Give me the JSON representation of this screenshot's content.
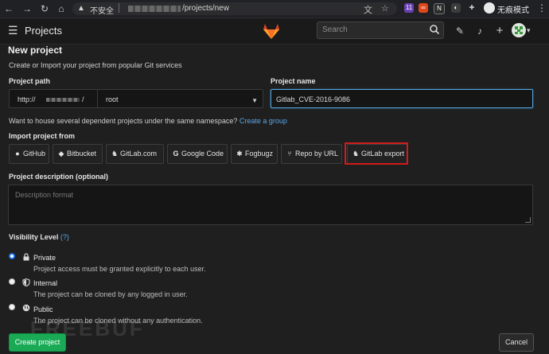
{
  "browser": {
    "security_label": "不安全",
    "url_path": "/projects/new",
    "ext_badge": "11",
    "incognito_label": "无痕模式"
  },
  "header": {
    "app_title": "Projects",
    "search_placeholder": "Search"
  },
  "page": {
    "title": "New project",
    "subtitle": "Create or Import your project from popular Git services"
  },
  "form": {
    "path_label": "Project path",
    "path_prefix": "http://",
    "path_suffix": "/",
    "namespace_value": "root",
    "name_label": "Project name",
    "name_value": "Gitlab_CVE-2016-9086",
    "namespace_hint": "Want to house several dependent projects under the same namespace?",
    "create_group_link": "Create a group",
    "import_label": "Import project from",
    "import_options": [
      "GitHub",
      "Bitbucket",
      "GitLab.com",
      "Google Code",
      "Fogbugz",
      "Repo by URL",
      "GitLab export"
    ],
    "description_label": "Project description (optional)",
    "description_placeholder": "Description format",
    "visibility_label": "Visibility Level",
    "visibility_help": "(?)",
    "visibility": [
      {
        "title": "Private",
        "desc": "Project access must be granted explicitly to each user.",
        "checked": true
      },
      {
        "title": "Internal",
        "desc": "The project can be cloned by any logged in user.",
        "checked": false
      },
      {
        "title": "Public",
        "desc": "The project can be cloned without any authentication.",
        "checked": false
      }
    ],
    "create_button": "Create project",
    "cancel_button": "Cancel"
  },
  "watermark": "FREEBUF",
  "colors": {
    "accent_green": "#1aaa55",
    "link_blue": "#5aa7e6",
    "highlight_red": "#d11b1b"
  }
}
